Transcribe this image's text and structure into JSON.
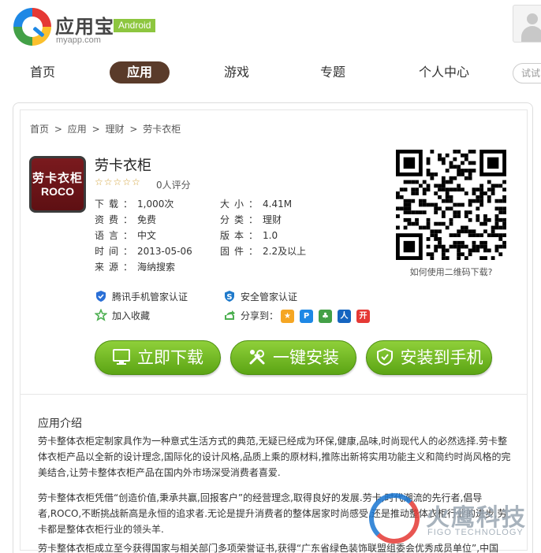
{
  "header": {
    "logo_text": "应用宝",
    "logo_badge": "Android",
    "logo_sub": "myapp.com"
  },
  "nav": {
    "items": [
      {
        "label": "首页"
      },
      {
        "label": "应用",
        "active": true
      },
      {
        "label": "游戏"
      },
      {
        "label": "专题"
      },
      {
        "label": "个人中心"
      }
    ],
    "search_placeholder": "试试"
  },
  "breadcrumb": [
    "首页",
    ">",
    "应用",
    ">",
    "理财",
    ">",
    "劳卡衣柜"
  ],
  "app": {
    "icon_text_1": "劳卡衣柜",
    "icon_text_2": "ROCO",
    "name": "劳卡衣柜",
    "stars": "☆☆☆☆☆",
    "rating": "0人评分",
    "rating_value": 0,
    "info_left": [
      {
        "key": "下载：",
        "value": "1,000次"
      },
      {
        "key": "资费：",
        "value": "免费"
      },
      {
        "key": "语言：",
        "value": "中文"
      },
      {
        "key": "时间：",
        "value": "2013-05-06"
      },
      {
        "key": "来源：",
        "value": "海纳搜索"
      }
    ],
    "info_right": [
      {
        "key": "大小：",
        "value": "4.41M"
      },
      {
        "key": "分类：",
        "value": "理财"
      },
      {
        "key": "版本：",
        "value": "1.0"
      },
      {
        "key": "固件：",
        "value": "2.2及以上"
      }
    ],
    "qr_caption": "如何使用二维码下载?"
  },
  "certs": {
    "tencent": "腾讯手机管家认证",
    "security": "安全管家认证",
    "favorite": "加入收藏",
    "share": "分享到："
  },
  "share_icons": [
    {
      "name": "qzone-share-icon",
      "color": "#f5a623",
      "glyph": "★"
    },
    {
      "name": "pengyou-share-icon",
      "color": "#1e88e5",
      "glyph": "P"
    },
    {
      "name": "clover-share-icon",
      "color": "#43a047",
      "glyph": "♣"
    },
    {
      "name": "renren-share-icon",
      "color": "#1565c0",
      "glyph": "人"
    },
    {
      "name": "kaixin-share-icon",
      "color": "#e53935",
      "glyph": "开"
    }
  ],
  "buttons": {
    "download": "立即下载",
    "one_click": "一键安装",
    "to_phone": "安装到手机"
  },
  "intro": {
    "title": "应用介绍",
    "p1": "劳卡整体衣柜定制家具作为一种意式生活方式的典范,无疑已经成为环保,健康,品味,时尚现代人的必然选择.劳卡整体衣柜产品以全新的设计理念,国际化的设计风格,品质上乘的原材料,推陈出新将实用功能主义和简约时尚风格的完美结合,让劳卡整体衣柜产品在国内外市场深受消费者喜爱.",
    "p2": "劳卡整体衣柜凭借“创造价值,秉承共赢,回报客户”的经营理念,取得良好的发展.劳卡,时代潮流的先行者,倡导者,ROCO,不断挑战新高是永恒的追求者.无论是提升消费者的整体居家时尚感受,还是推动整体衣柜行业的进步,劳卡都是整体衣柜行业的领头羊.",
    "p3": "劳卡整体衣柜成立至今获得国家与相关部门多项荣誉证书,获得“广东省绿色装饰联盟组委会优秀成员单位”,中国"
  },
  "watermark": {
    "text": "火鹰科技",
    "sub": "FIGO TECHNOLOGY"
  }
}
